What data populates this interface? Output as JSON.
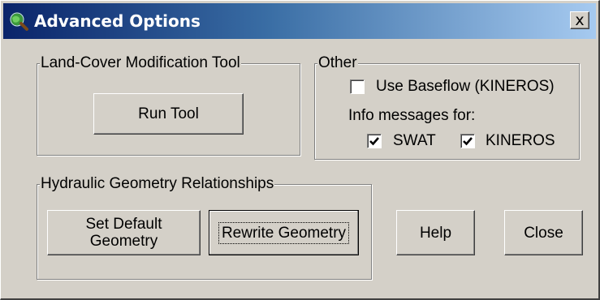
{
  "window": {
    "title": "Advanced Options",
    "close_glyph": "x",
    "icon": "globe-magnifier-icon"
  },
  "land_cover": {
    "legend": "Land-Cover Modification Tool",
    "run_label": "Run Tool"
  },
  "other": {
    "legend": "Other",
    "use_baseflow": {
      "label": "Use Baseflow (KINEROS)",
      "checked": false
    },
    "info_label": "Info messages for:",
    "swat": {
      "label": "SWAT",
      "checked": true
    },
    "kineros": {
      "label": "KINEROS",
      "checked": true
    }
  },
  "hydraulic": {
    "legend": "Hydraulic Geometry Relationships",
    "set_default_line1": "Set Default",
    "set_default_line2": "Geometry",
    "rewrite_label": "Rewrite Geometry"
  },
  "buttons": {
    "help_label": "Help",
    "close_label": "Close"
  }
}
